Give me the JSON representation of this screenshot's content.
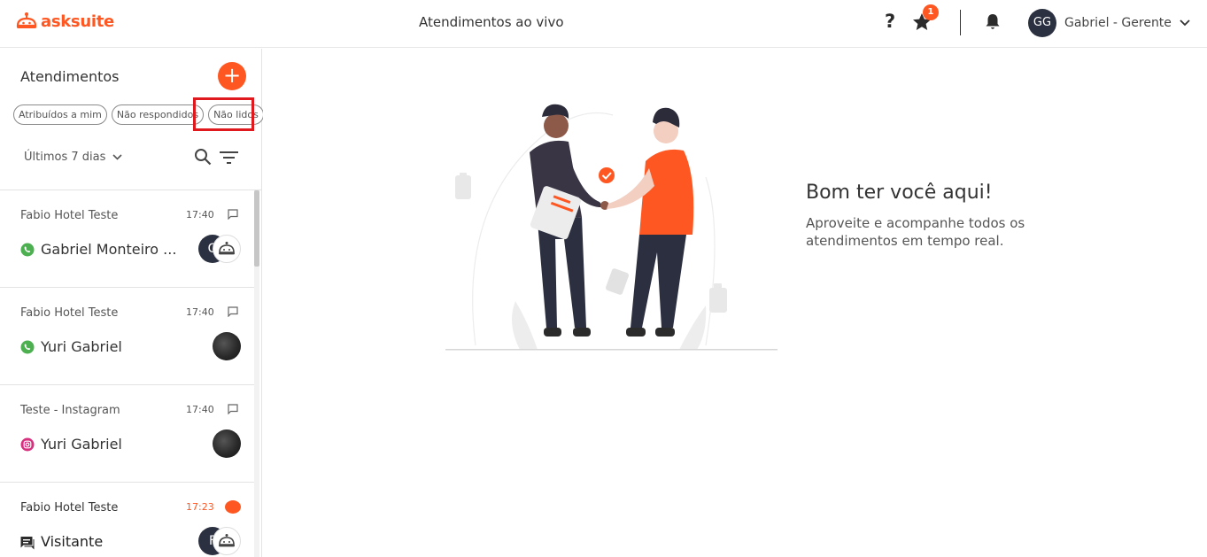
{
  "app": {
    "logo_text": "asksuite",
    "page_title": "Atendimentos ao vivo",
    "brand_color": "#ff5722"
  },
  "header": {
    "help_symbol": "?",
    "star_badge": "1",
    "user_initials": "GG",
    "user_name": "Gabriel - Gerente"
  },
  "sidebar": {
    "title": "Atendimentos",
    "add_symbol": "+",
    "filters": [
      "Atribuídos a mim",
      "Não respondidos",
      "Não lidos"
    ],
    "highlighted_filter": "Não lidos",
    "period": "Últimos 7 dias"
  },
  "conversations": [
    {
      "hotel": "Fabio Hotel Teste",
      "time": "17:40",
      "channel": "whatsapp",
      "name": "Gabriel Monteiro ...",
      "agent_initial": "G",
      "unread": false
    },
    {
      "hotel": "Fabio Hotel Teste",
      "time": "17:40",
      "channel": "whatsapp",
      "name": "Yuri Gabriel",
      "agent_initial": "",
      "unread": false
    },
    {
      "hotel": "Teste - Instagram",
      "time": "17:40",
      "channel": "instagram",
      "name": "Yuri Gabriel",
      "agent_initial": "",
      "unread": false
    },
    {
      "hotel": "Fabio Hotel Teste",
      "time": "17:23",
      "channel": "webchat",
      "name": "Visitante",
      "agent_initial": "F",
      "unread": true
    }
  ],
  "main": {
    "welcome_title": "Bom ter você aqui!",
    "welcome_text": "Aproveite e acompanhe todos os atendimentos em tempo real."
  }
}
